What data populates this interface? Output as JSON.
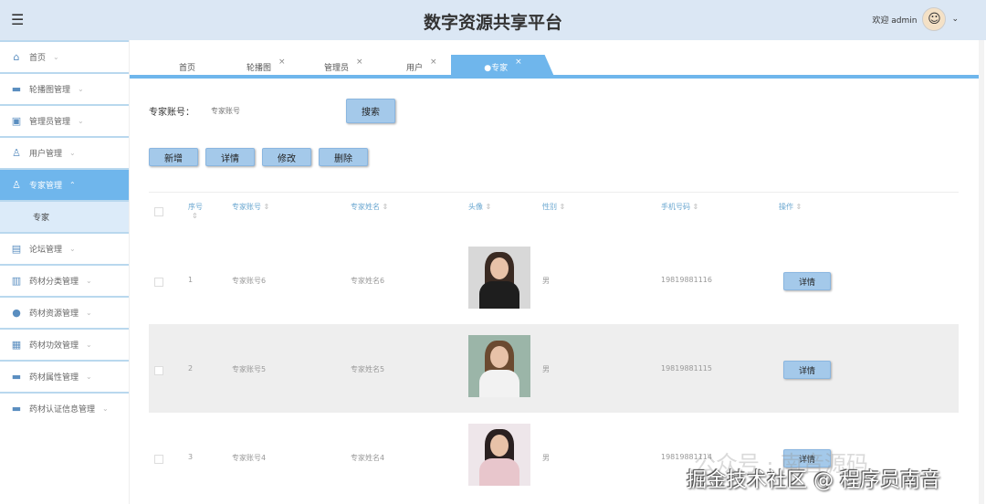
{
  "header": {
    "title": "数字资源共享平台",
    "welcome": "欢迎 admin",
    "menu_icon": "hamburger-icon"
  },
  "sidebar": {
    "items": [
      {
        "label": "首页",
        "icon": "⌂"
      },
      {
        "label": "轮播图管理",
        "icon": "▬"
      },
      {
        "label": "管理员管理",
        "icon": "▣"
      },
      {
        "label": "用户管理",
        "icon": "♙"
      },
      {
        "label": "专家管理",
        "icon": "♙"
      },
      {
        "label": "专家",
        "icon": ""
      },
      {
        "label": "论坛管理",
        "icon": "▤"
      },
      {
        "label": "药材分类管理",
        "icon": "▥"
      },
      {
        "label": "药材资源管理",
        "icon": "●"
      },
      {
        "label": "药材功效管理",
        "icon": "▦"
      },
      {
        "label": "药材属性管理",
        "icon": "▬"
      },
      {
        "label": "药材认证信息管理",
        "icon": "▬"
      }
    ]
  },
  "tabs": [
    {
      "label": "首页"
    },
    {
      "label": "轮播图"
    },
    {
      "label": "管理员"
    },
    {
      "label": "用户"
    },
    {
      "label": "●专家"
    }
  ],
  "tab_close": "×",
  "search": {
    "label": "专家账号：",
    "placeholder": "专家账号",
    "button": "搜索"
  },
  "toolbar": {
    "add": "新增",
    "detail": "详情",
    "edit": "修改",
    "delete": "删除"
  },
  "table": {
    "headers": [
      "序号",
      "专家账号",
      "专家姓名",
      "头像",
      "性别",
      "手机号码",
      "操作"
    ],
    "sort_glyph": "⇕",
    "rows": [
      {
        "index": "1",
        "account": "专家账号6",
        "name": "专家姓名6",
        "gender": "男",
        "phone": "19819881116",
        "action": "详情"
      },
      {
        "index": "2",
        "account": "专家账号5",
        "name": "专家姓名5",
        "gender": "男",
        "phone": "19819881115",
        "action": "详情"
      },
      {
        "index": "3",
        "account": "专家账号4",
        "name": "专家姓名4",
        "gender": "男",
        "phone": "19819881114",
        "action": "详情"
      }
    ]
  },
  "watermark": {
    "line1": "公众号 · 南音源码",
    "line2": "掘金技术社区 @ 程序员南音"
  }
}
